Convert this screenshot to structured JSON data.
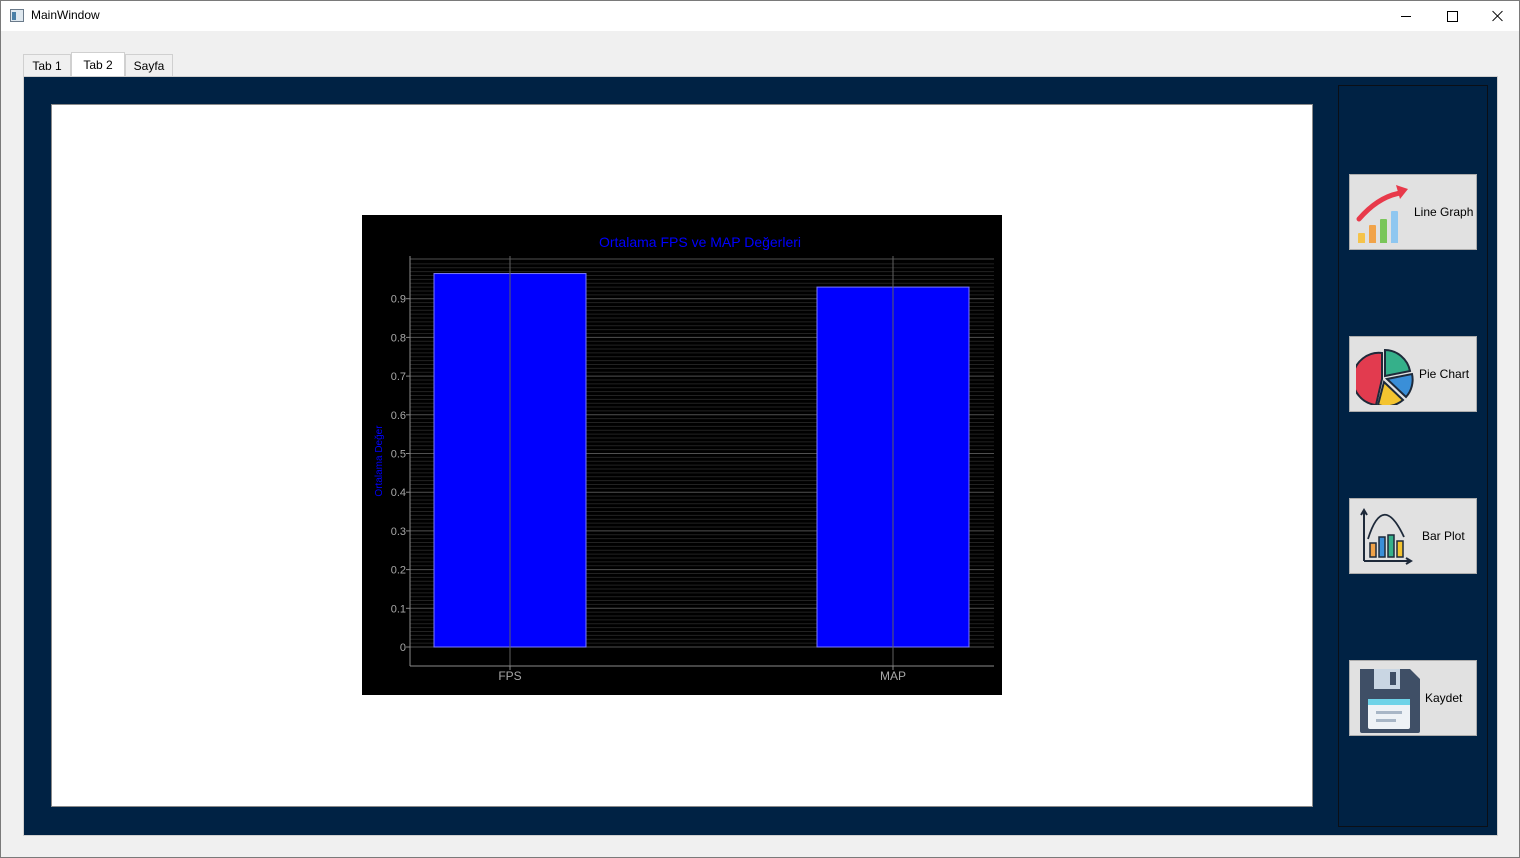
{
  "window": {
    "title": "MainWindow"
  },
  "tabs": [
    {
      "label": "Tab 1",
      "active": false
    },
    {
      "label": "Tab 2",
      "active": true
    },
    {
      "label": "Sayfa",
      "active": false
    }
  ],
  "side_buttons": [
    {
      "label": "Line Graph",
      "icon": "line-graph-icon"
    },
    {
      "label": "Pie Chart",
      "icon": "pie-chart-icon"
    },
    {
      "label": "Bar Plot",
      "icon": "bar-plot-icon"
    },
    {
      "label": "Kaydet",
      "icon": "save-floppy-icon"
    }
  ],
  "colors": {
    "pane_background": "#002244",
    "chart_background": "#000000",
    "bar_fill": "#0000ff",
    "title_color": "#0000ff"
  },
  "chart_data": {
    "type": "bar",
    "title": "Ortalama FPS ve MAP Değerleri",
    "xlabel": "",
    "ylabel": "Ortalama Değer",
    "categories": [
      "FPS",
      "MAP"
    ],
    "values": [
      0.965,
      0.93
    ],
    "ylim": [
      0,
      1.0
    ],
    "yticks": [
      "0",
      "0.1",
      "0.2",
      "0.3",
      "0.4",
      "0.5",
      "0.6",
      "0.7",
      "0.8",
      "0.9"
    ],
    "grid": true
  }
}
